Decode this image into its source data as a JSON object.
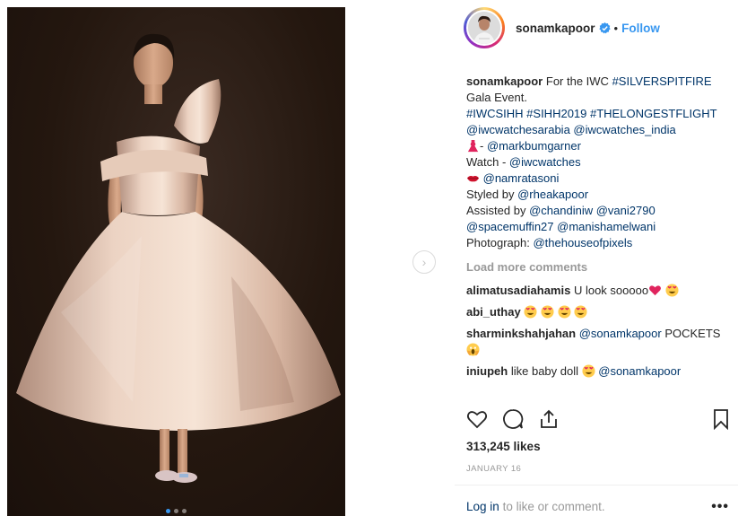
{
  "post": {
    "username": "sonamkapoor",
    "separator": "•",
    "follow_label": "Follow"
  },
  "caption": {
    "username": "sonamkapoor",
    "l1_text": "For the IWC",
    "l1_tag": "#SILVERSPITFIRE",
    "l2": "Gala Event.",
    "l3_tags": "#IWCSIHH #SIHH2019 #THELONGESTFLIGHT",
    "l4_mentions": "@iwcwatchesarabia @iwcwatches_india",
    "l5_prefix": "- ",
    "l5_mention": "@markbumgarner",
    "l6_text": "Watch - ",
    "l6_mention": "@iwcwatches",
    "l7_mention": "@namratasoni",
    "l8_text": "Styled by ",
    "l8_mention": "@rheakapoor",
    "l9_text": "Assisted by ",
    "l9_mention": "@chandiniw @vani2790",
    "l10_mentions": "@spacemuffin27 @manishamelwani",
    "l11_text": "Photograph: ",
    "l11_mention": "@thehouseofpixels"
  },
  "load_more_label": "Load more comments",
  "comments": [
    {
      "user": "alimatusadiahamis",
      "text": "U look sooooo"
    },
    {
      "user": "abi_uthay",
      "text": ""
    },
    {
      "user": "sharminkshahjahan",
      "mention": "@sonamkapoor",
      "text": "POCKETS"
    },
    {
      "user": "iniupeh",
      "text": "like baby doll",
      "mention": "@sonamkapoor"
    }
  ],
  "likes_label": "313,245 likes",
  "date_label": "JANUARY 16",
  "login": {
    "link": "Log in",
    "text": "to like or comment."
  },
  "more_label": "•••",
  "icons": {
    "verified": "verified-badge-icon",
    "like": "heart-icon",
    "comment": "comment-bubble-icon",
    "share": "share-icon",
    "save": "bookmark-icon",
    "next": "chevron-right-icon"
  },
  "colors": {
    "accent": "#3897f0",
    "link": "#003569",
    "muted": "#999999"
  },
  "carousel": {
    "count": 3,
    "active_index": 0
  }
}
